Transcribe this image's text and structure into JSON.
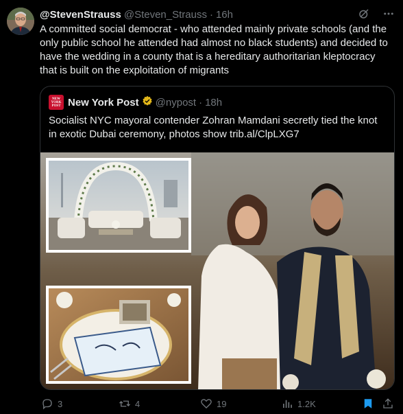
{
  "author": {
    "display_name": "@StevenStrauss",
    "handle": "@Steven_Strauss",
    "time": "16h",
    "text": "A committed social democrat - who attended mainly private schools (and the only public school he attended had almost no black students) and decided to have the wedding in a county that is a hereditary authoritarian kleptocracy that is built on the exploitation of migrants"
  },
  "quoted": {
    "logo_lines": [
      "NEW",
      "YORK",
      "POST"
    ],
    "name": "New York Post",
    "handle": "@nypost",
    "time": "18h",
    "text": "Socialist NYC mayoral contender Zohran Mamdani secretly tied the knot in exotic Dubai ceremony, photos show trib.al/ClpLXG7"
  },
  "actions": {
    "replies": "3",
    "reposts": "4",
    "likes": "19",
    "views": "1.2K"
  },
  "icons": {
    "header": [
      "grok-icon",
      "more-icon"
    ],
    "actions": [
      "reply-icon",
      "repost-icon",
      "like-icon",
      "views-icon",
      "bookmark-icon",
      "share-icon"
    ]
  },
  "colors": {
    "background": "#000000",
    "text": "#e7e9ea",
    "muted": "#71767b",
    "border": "#2f3336",
    "verified_gold": "#e2b719",
    "bookmark_blue": "#1d9bf0",
    "nypost_red": "#c8102e"
  }
}
